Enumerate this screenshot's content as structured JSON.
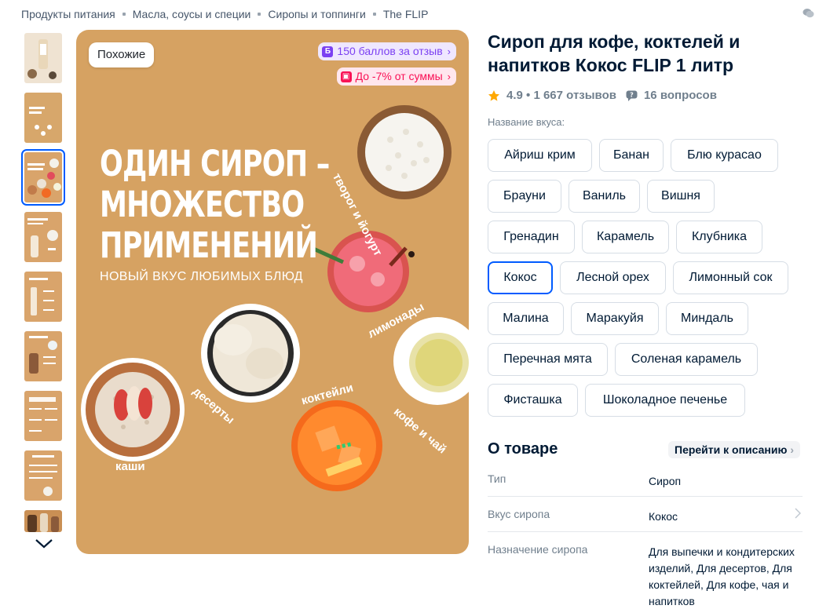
{
  "breadcrumb": [
    "Продукты питания",
    "Масла, соусы и специи",
    "Сиропы и топпинги",
    "The FLIP"
  ],
  "gallery": {
    "similar_label": "Похожие",
    "points_badge": "150 баллов за отзыв",
    "discount_badge": "До -7% от суммы",
    "hero_title_lines": [
      "ОДИН СИРОП –",
      "МНОЖЕСТВО",
      "ПРИМЕНЕНИЙ"
    ],
    "hero_subtitle": "НОВЫЙ ВКУС ЛЮБИМЫХ БЛЮД",
    "food_labels": {
      "tvorog": "творог и йогурт",
      "limonady": "лимонады",
      "deserty": "десерты",
      "kokteyli": "коктейли",
      "kofe": "кофе и чай",
      "kashi": "каши"
    }
  },
  "product": {
    "title": "Сироп для кофе, коктелей и напитков Кокос FLIP 1 литр",
    "rating": "4.9",
    "reviews": "1 667 отзывов",
    "questions": "16 вопросов",
    "flavor_label": "Название вкуса:",
    "flavors": [
      "Айриш крим",
      "Банан",
      "Блю курасао",
      "Брауни",
      "Ваниль",
      "Вишня",
      "Гренадин",
      "Карамель",
      "Клубника",
      "Кокос",
      "Лесной орех",
      "Лимонный сок",
      "Малина",
      "Маракуйя",
      "Миндаль",
      "Перечная мята",
      "Соленая карамель",
      "Фисташка",
      "Шоколадное печенье"
    ],
    "selected_flavor": "Кокос"
  },
  "about": {
    "title": "О товаре",
    "go_to_description": "Перейти к описанию",
    "specs": [
      {
        "key": "Тип",
        "value": "Сироп"
      },
      {
        "key": "Вкус сиропа",
        "value": "Кокос"
      },
      {
        "key": "Назначение сиропа",
        "value": "Для выпечки и кондитерских изделий, Для десертов, Для коктейлей, Для кофе, чая и напитков"
      }
    ]
  },
  "colors": {
    "accent": "#005bff",
    "image_bg": "#d6a262",
    "points": "#7b40f2",
    "discount": "#f91155",
    "star": "#ffa800"
  }
}
